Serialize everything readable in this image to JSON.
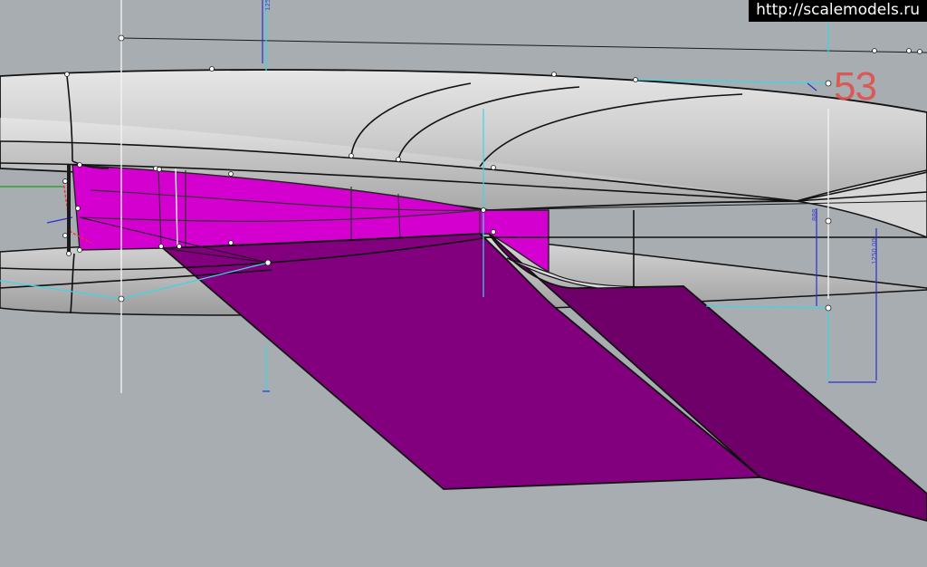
{
  "watermark": {
    "text": "http://scalemodels.ru"
  },
  "markers": {
    "number": "53"
  },
  "dimensions": {
    "vertical_long": "1250,00",
    "vertical_short": "888",
    "top_left": "125"
  },
  "colors": {
    "background": "#a8adb1",
    "fuselage": "#c8c8c8",
    "highlight_magenta": "#d400d0",
    "wing_purple": "#84007e",
    "dimension_blue": "#2a2fd0",
    "construction_cyan": "#39d7e6"
  }
}
